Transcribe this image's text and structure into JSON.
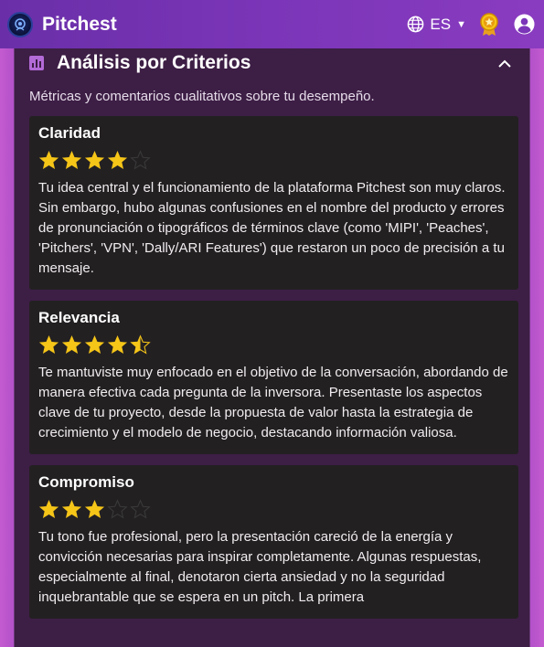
{
  "header": {
    "brand": "Pitchest",
    "language": "ES",
    "icons": [
      "logo-icon",
      "globe-icon",
      "chevron-down-icon",
      "award-icon",
      "user-icon"
    ]
  },
  "section": {
    "title": "Análisis por Criterios",
    "subtitle": "Métricas y comentarios cualitativos sobre tu desempeño.",
    "collapse_icon": "chevron-up-icon"
  },
  "criteria": [
    {
      "name": "Claridad",
      "rating": 4,
      "max": 5,
      "text": "Tu idea central y el funcionamiento de la plataforma Pitchest son muy claros. Sin embargo, hubo algunas confusiones en el nombre del producto y errores de pronunciación o tipográficos de términos clave (como 'MIPI', 'Peaches', 'Pitchers', 'VPN', 'Dally/ARI Features') que restaron un poco de precisión a tu mensaje."
    },
    {
      "name": "Relevancia",
      "rating": 4.5,
      "max": 5,
      "text": "Te mantuviste muy enfocado en el objetivo de la conversación, abordando de manera efectiva cada pregunta de la inversora. Presentaste los aspectos clave de tu proyecto, desde la propuesta de valor hasta la estrategia de crecimiento y el modelo de negocio, destacando información valiosa."
    },
    {
      "name": "Compromiso",
      "rating": 3,
      "max": 5,
      "text": "Tu tono fue profesional, pero la presentación careció de la energía y convicción necesarias para inspirar completamente. Algunas respuestas, especialmente al final, denotaron cierta ansiedad y no la seguridad inquebrantable que se espera en un pitch. La primera"
    }
  ],
  "colors": {
    "star": "#f5c518",
    "star_empty": "#3a3a3a",
    "header": "#7b35b8",
    "panel": "#3d1e45",
    "card": "#232022"
  }
}
